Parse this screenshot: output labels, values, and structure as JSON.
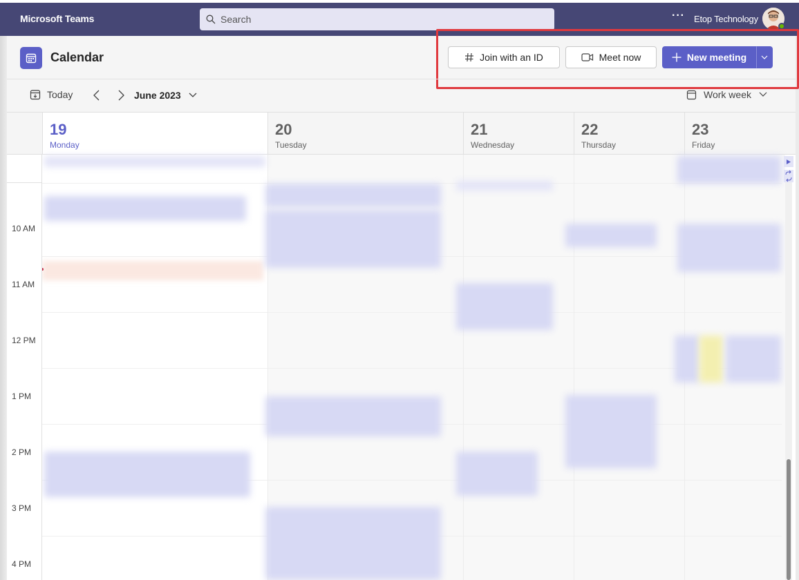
{
  "titlebar": {
    "app_name": "Microsoft Teams",
    "search_placeholder": "Search",
    "org_name": "Etop Technology",
    "more_label": "···"
  },
  "header": {
    "title": "Calendar",
    "join_label": "Join with an ID",
    "meet_label": "Meet now",
    "new_meeting_label": "New meeting"
  },
  "toolbar": {
    "today_label": "Today",
    "month_label": "June 2023",
    "view_label": "Work week"
  },
  "days": [
    {
      "num": "19",
      "name": "Monday"
    },
    {
      "num": "20",
      "name": "Tuesday"
    },
    {
      "num": "21",
      "name": "Wednesday"
    },
    {
      "num": "22",
      "name": "Thursday"
    },
    {
      "num": "23",
      "name": "Friday"
    }
  ],
  "times": [
    "10 AM",
    "11 AM",
    "12 PM",
    "1 PM",
    "2 PM",
    "3 PM",
    "4 PM"
  ],
  "colors": {
    "titlebar": "#464775",
    "accent": "#5b5fc7",
    "highlight": "#e0393e",
    "event": "#d7d9f4"
  }
}
